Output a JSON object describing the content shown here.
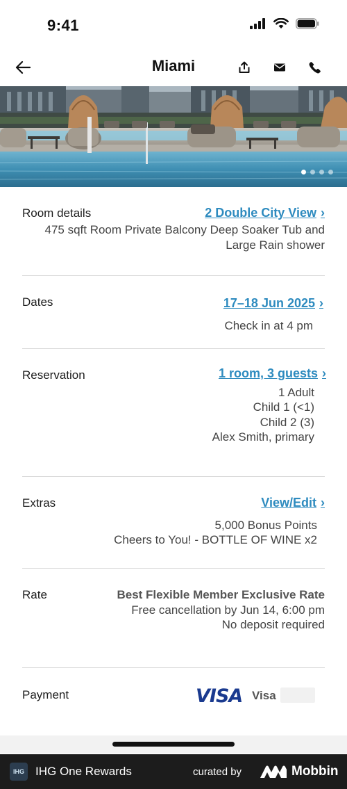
{
  "status_bar": {
    "time": "9:41"
  },
  "nav": {
    "title": "Miami"
  },
  "hero": {
    "slide_count": 4,
    "active_slide": 1
  },
  "room_details": {
    "label": "Room details",
    "link": "2 Double City View",
    "description_line1": "475 sqft Room Private Balcony Deep Soaker Tub and",
    "description_line2": "Large Rain shower"
  },
  "dates": {
    "label": "Dates",
    "link": "17–18 Jun 2025",
    "checkin": "Check in at 4 pm"
  },
  "reservation": {
    "label": "Reservation",
    "link": "1 room, 3 guests",
    "guests": [
      "1 Adult",
      "Child 1 (<1)",
      "Child 2 (3)",
      "Alex Smith, primary"
    ]
  },
  "extras": {
    "label": "Extras",
    "link": "View/Edit",
    "items": [
      "5,000 Bonus Points",
      "Cheers to You! - BOTTLE OF WINE x2"
    ]
  },
  "rate": {
    "label": "Rate",
    "name": "Best Flexible Member Exclusive Rate",
    "cancellation": "Free cancellation by Jun 14, 6:00 pm",
    "deposit": "No deposit required"
  },
  "payment": {
    "label": "Payment",
    "card_logo": "VISA",
    "card_name": "Visa"
  },
  "footer": {
    "app_logo": "IHG",
    "app_name": "IHG One Rewards",
    "curated_by": "curated by",
    "brand": "Mobbin"
  },
  "colors": {
    "link": "#2e8bbf",
    "visa": "#1a3a8f",
    "footer_bg": "#1c1c1c"
  }
}
